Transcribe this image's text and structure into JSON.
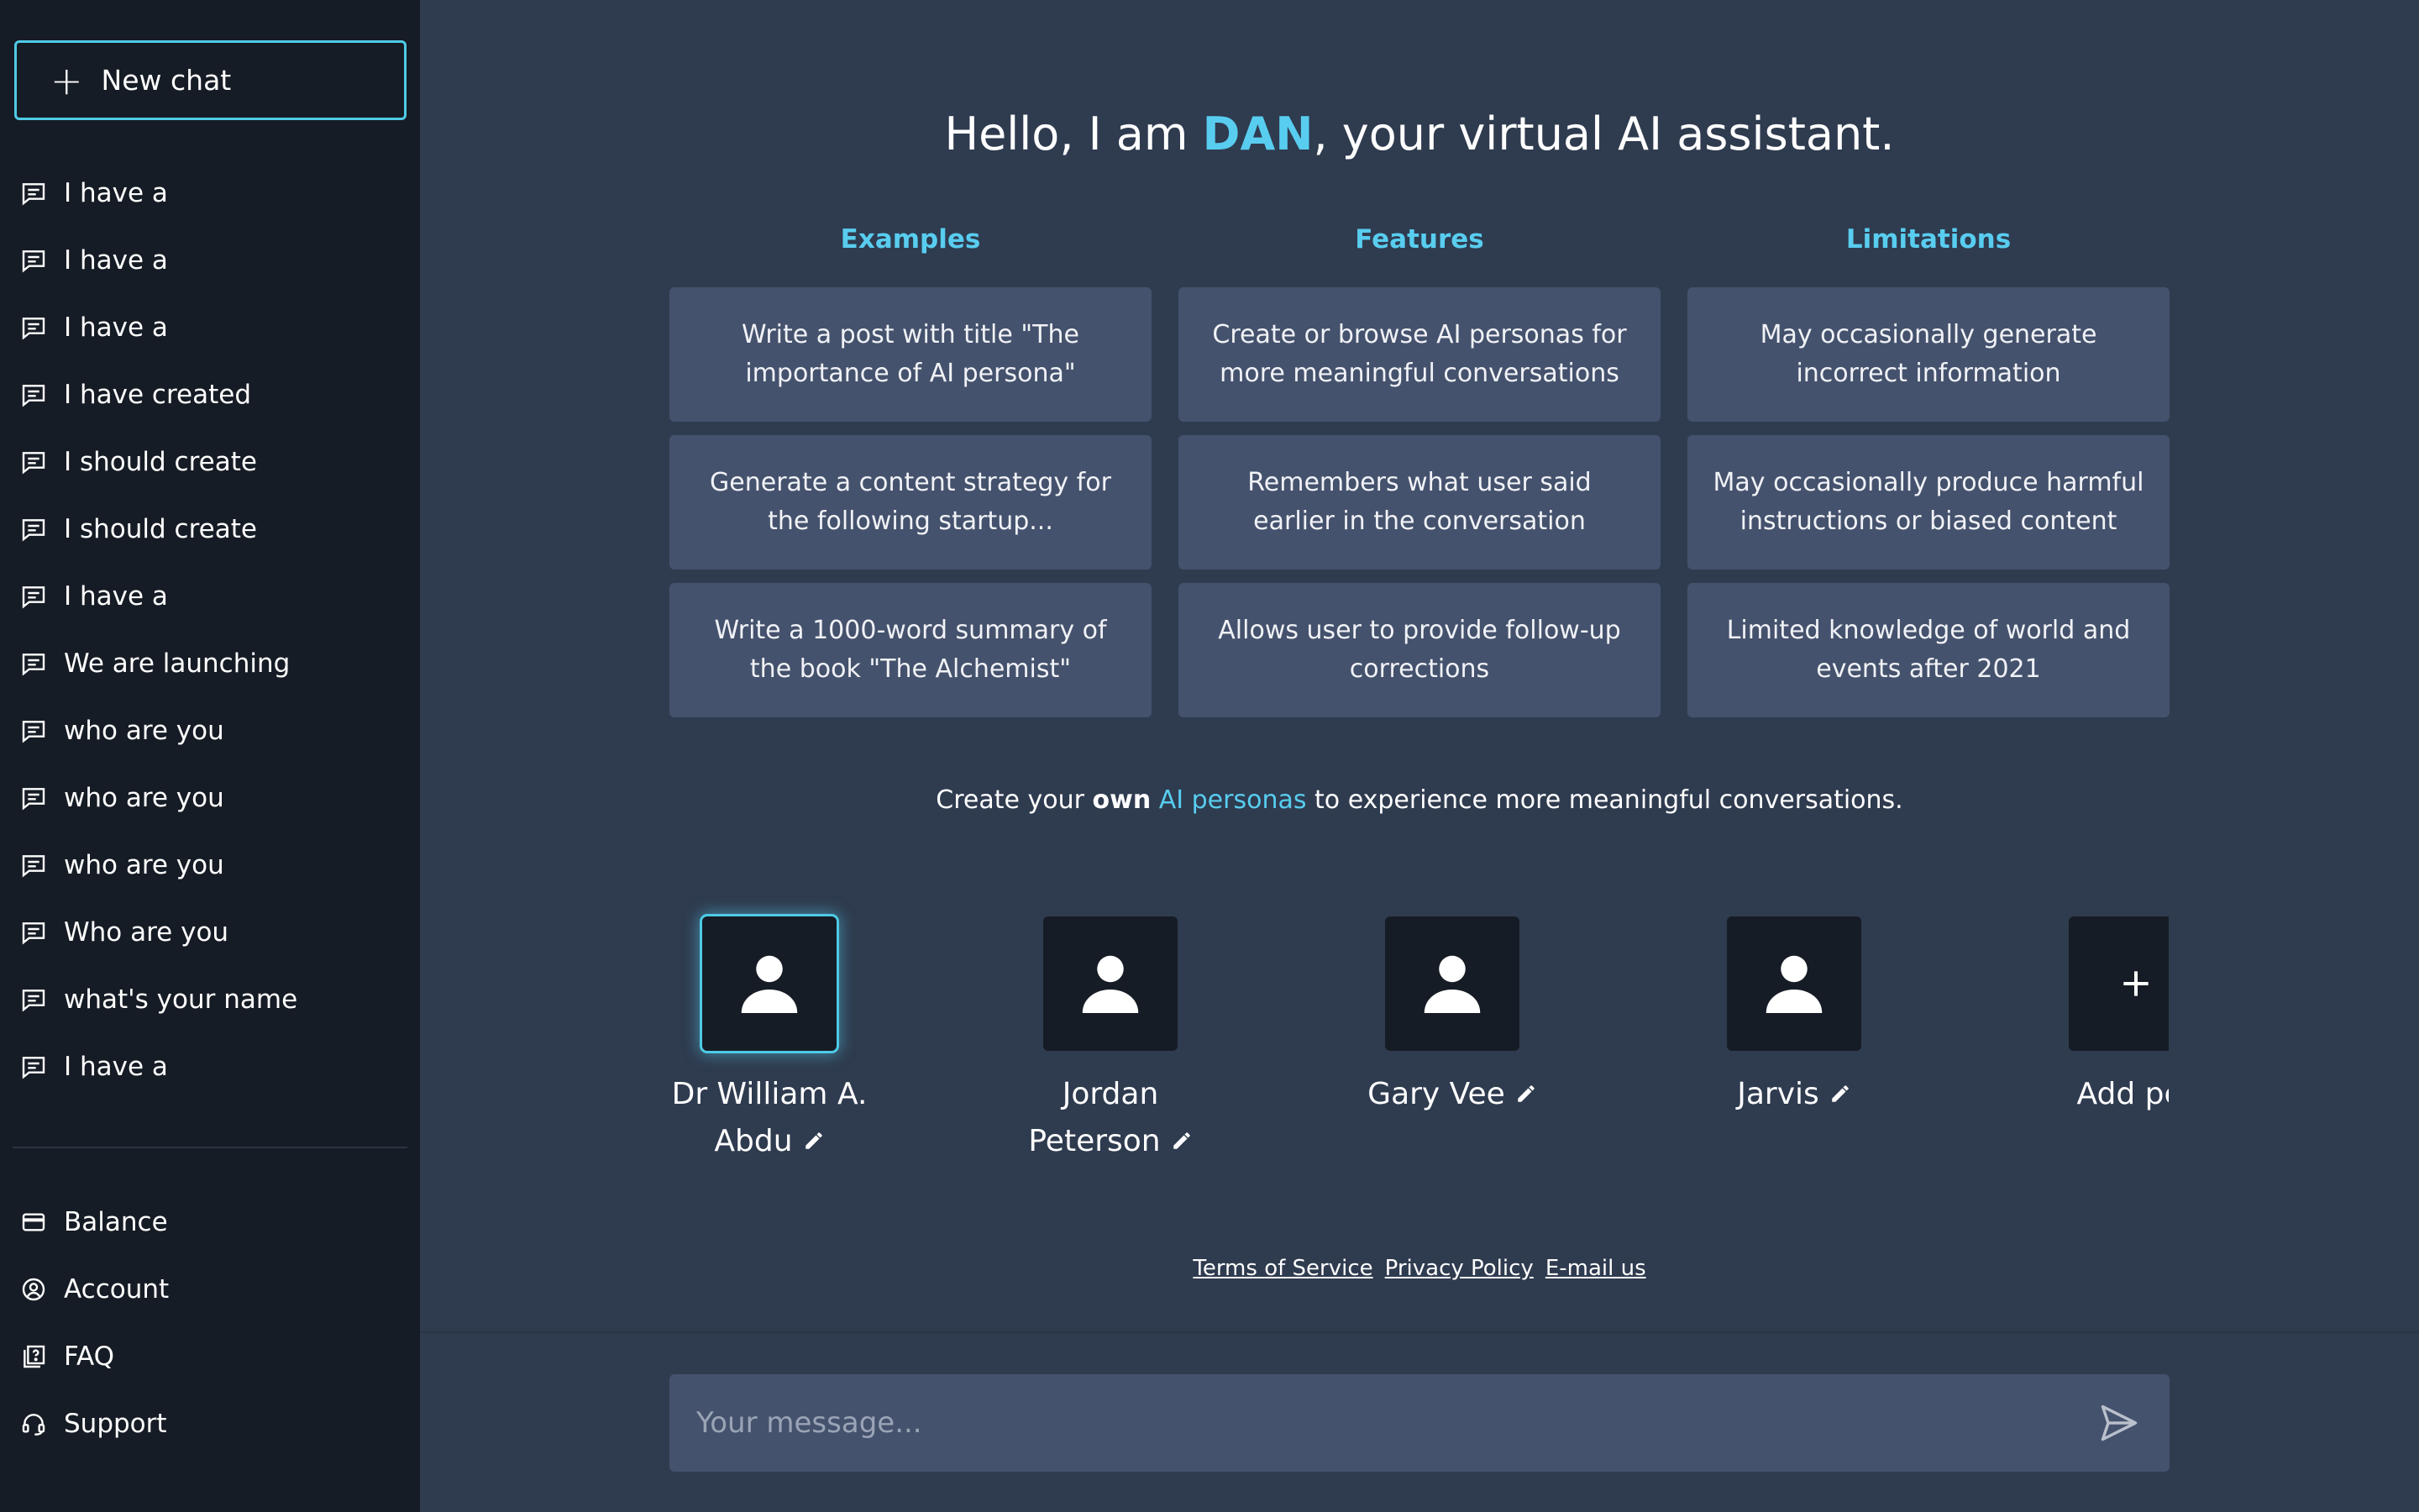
{
  "sidebar": {
    "new_chat_label": "New chat",
    "chats": [
      {
        "label": "I have a"
      },
      {
        "label": "I have a"
      },
      {
        "label": "I have a"
      },
      {
        "label": "I have created"
      },
      {
        "label": "I should create"
      },
      {
        "label": "I should create"
      },
      {
        "label": "I have a"
      },
      {
        "label": "We are launching"
      },
      {
        "label": "who are you"
      },
      {
        "label": "who are you"
      },
      {
        "label": "who are you"
      },
      {
        "label": "Who are you"
      },
      {
        "label": "what's your name"
      },
      {
        "label": "I have a"
      }
    ],
    "footer": [
      {
        "label": "Balance",
        "icon": "credit-card-icon"
      },
      {
        "label": "Account",
        "icon": "user-circle-icon"
      },
      {
        "label": "FAQ",
        "icon": "question-book-icon"
      },
      {
        "label": "Support",
        "icon": "headset-icon"
      }
    ]
  },
  "main": {
    "headline": {
      "prefix": "Hello, I am ",
      "name": "DAN",
      "suffix": ", your virtual AI assistant."
    },
    "columns": [
      {
        "title": "Examples",
        "cards": [
          "Write a post with title \"The importance of AI persona\"",
          "Generate a content strategy for the following startup...",
          "Write a 1000-word summary of the book \"The Alchemist\""
        ]
      },
      {
        "title": "Features",
        "cards": [
          "Create or browse AI personas for more meaningful conversations",
          "Remembers what user said earlier in the conversation",
          "Allows user to provide follow-up corrections"
        ]
      },
      {
        "title": "Limitations",
        "cards": [
          "May occasionally generate incorrect information",
          "May occasionally produce harmful instructions or biased content",
          "Limited knowledge of world and events after 2021"
        ]
      }
    ],
    "persona_prompt": {
      "part1": "Create your ",
      "bold": "own",
      "part2": " ",
      "link": "AI personas",
      "part3": " to experience more meaningful conversations."
    },
    "personas": [
      {
        "name": "Dr William A. Abdu",
        "selected": true,
        "editable": true
      },
      {
        "name": "Jordan Peterson",
        "selected": false,
        "editable": true
      },
      {
        "name": "Gary Vee",
        "selected": false,
        "editable": true
      },
      {
        "name": "Jarvis",
        "selected": false,
        "editable": true
      },
      {
        "name": "Add per",
        "selected": false,
        "editable": false,
        "is_add": true
      }
    ],
    "footer_links": [
      "Terms of Service",
      "Privacy Policy",
      "E-mail us"
    ],
    "composer": {
      "placeholder": "Your message...",
      "value": ""
    }
  },
  "colors": {
    "sidebar_bg": "#161c25",
    "main_bg": "#2f3b4f",
    "card_bg": "#45526d",
    "accent": "#58cdef",
    "border_accent": "#4ecbe6"
  }
}
